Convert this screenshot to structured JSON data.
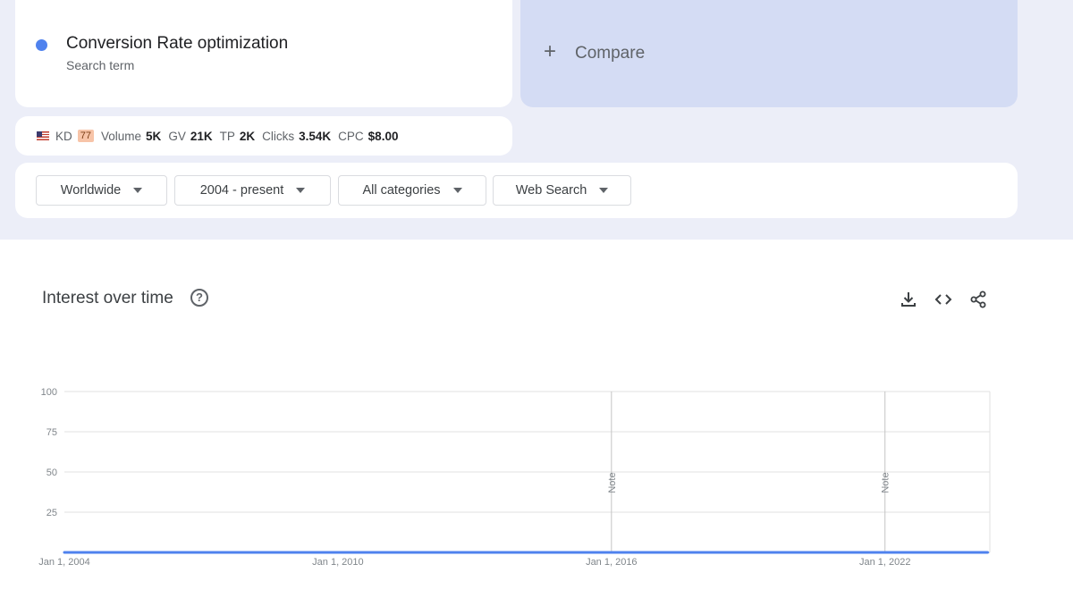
{
  "term": {
    "title": "Conversion Rate optimization",
    "subtitle": "Search term",
    "dot_color": "#4f82ee"
  },
  "compare": {
    "plus": "+",
    "label": "Compare"
  },
  "metrics": {
    "flag_icon": "us-flag-icon",
    "kd_label": "KD",
    "kd_value": "77",
    "volume_label": "Volume",
    "volume_value": "5K",
    "gv_label": "GV",
    "gv_value": "21K",
    "tp_label": "TP",
    "tp_value": "2K",
    "clicks_label": "Clicks",
    "clicks_value": "3.54K",
    "cpc_label": "CPC",
    "cpc_value": "$8.00"
  },
  "filters": {
    "region": "Worldwide",
    "time": "2004 - present",
    "category": "All categories",
    "search_type": "Web Search"
  },
  "chart_header": {
    "title": "Interest over time",
    "help": "?",
    "tools": [
      "download-icon",
      "embed-code-icon",
      "share-icon"
    ]
  },
  "chart_data": {
    "type": "line",
    "title": "",
    "line_color": "#4f82ee",
    "grid": true,
    "y_ticks": [
      25,
      50,
      75,
      100
    ],
    "ylim": [
      0,
      100
    ],
    "x_ticks": [
      "Jan 1, 2004",
      "Jan 1, 2010",
      "Jan 1, 2016",
      "Jan 1, 2022"
    ],
    "xlim": [
      2004.0,
      2024.3
    ],
    "notes": [
      {
        "x": 2016.0,
        "label": "Note"
      },
      {
        "x": 2022.0,
        "label": "Note"
      }
    ],
    "series": [
      {
        "name": "",
        "x": [
          2004.0,
          2005.0,
          2006.0,
          2007.0,
          2008.0,
          2009.0,
          2010.0,
          2010.5,
          2010.67,
          2010.75,
          2010.83,
          2010.92,
          2011.0,
          2011.08,
          2011.17,
          2011.25,
          2011.33,
          2011.42,
          2011.5,
          2011.58,
          2011.67,
          2011.75,
          2011.83,
          2011.92,
          2012.0,
          2012.08,
          2012.17,
          2012.25,
          2012.33,
          2012.42,
          2012.5,
          2012.58,
          2012.67,
          2012.75,
          2012.83,
          2012.92,
          2013.0,
          2013.08,
          2013.17,
          2013.25,
          2013.33,
          2013.42,
          2013.5,
          2013.58,
          2013.67,
          2013.75,
          2013.83,
          2013.92,
          2014.0,
          2014.08,
          2014.17,
          2014.25,
          2014.33,
          2014.42,
          2014.5,
          2014.58,
          2014.67,
          2014.75,
          2014.83,
          2014.92,
          2015.0,
          2015.08,
          2015.17,
          2015.25,
          2015.33,
          2015.42,
          2015.5,
          2015.58,
          2015.67,
          2015.75,
          2015.83,
          2015.92,
          2016.0,
          2016.08,
          2016.17,
          2016.25,
          2016.33,
          2016.42,
          2016.5,
          2016.58,
          2016.67,
          2016.75,
          2016.83,
          2016.92,
          2017.0,
          2017.08,
          2017.17,
          2017.25,
          2017.33,
          2017.42,
          2017.5,
          2017.58,
          2017.67,
          2017.75,
          2017.83,
          2017.92,
          2018.0,
          2018.08,
          2018.17,
          2018.25,
          2018.33,
          2018.42,
          2018.5,
          2018.58,
          2018.67,
          2018.75,
          2018.83,
          2018.92,
          2019.0,
          2019.08,
          2019.17,
          2019.25,
          2019.33,
          2019.42,
          2019.5,
          2019.58,
          2019.67,
          2019.75,
          2019.83,
          2019.92,
          2020.0,
          2020.08,
          2020.17,
          2020.25,
          2020.33,
          2020.42,
          2020.5,
          2020.58,
          2020.67,
          2020.75,
          2020.83,
          2020.92,
          2021.0,
          2021.08,
          2021.17,
          2021.25,
          2021.33,
          2021.42,
          2021.5,
          2021.58,
          2021.67,
          2021.75,
          2021.83,
          2021.92,
          2022.0,
          2022.08,
          2022.17,
          2022.25,
          2022.33,
          2022.42,
          2022.5,
          2022.58,
          2022.67,
          2022.75,
          2022.83,
          2022.92,
          2023.0,
          2023.08,
          2023.17,
          2023.25,
          2023.33,
          2023.42,
          2023.5,
          2023.58,
          2023.67,
          2023.75,
          2023.83,
          2023.92,
          2024.0,
          2024.08,
          2024.17,
          2024.25
        ],
        "values": [
          0,
          0,
          0,
          0,
          0,
          0,
          0,
          0,
          0,
          0,
          0,
          0,
          0,
          0,
          0,
          0,
          0,
          0,
          0,
          0,
          0,
          0,
          0,
          0,
          0,
          0,
          0,
          0,
          0,
          0,
          0,
          0,
          0,
          0,
          0,
          0,
          0,
          0,
          0,
          0,
          0,
          0,
          0,
          0,
          0,
          0,
          0,
          0,
          0,
          0,
          0,
          0,
          0,
          0,
          0,
          0,
          0,
          0,
          0,
          0,
          0,
          0,
          0,
          0,
          0,
          0,
          0,
          0,
          0,
          0,
          0,
          0,
          0,
          0,
          0,
          0,
          0,
          0,
          0,
          0,
          0,
          0,
          0,
          0,
          0,
          0,
          0,
          0,
          0,
          0,
          0,
          0,
          0,
          0,
          0,
          0,
          0,
          0,
          0,
          0,
          0,
          0,
          0,
          0,
          0,
          0,
          0,
          0,
          0,
          0,
          0,
          0,
          0,
          0,
          0,
          0,
          0,
          0,
          0,
          0,
          0,
          0,
          0,
          0,
          0,
          0,
          0,
          0,
          0,
          0,
          0,
          0,
          0,
          0,
          0,
          0,
          0,
          0,
          0,
          0,
          0,
          0,
          0,
          0,
          0,
          0,
          0,
          0,
          0,
          0,
          0,
          0,
          0,
          0,
          0,
          0,
          0,
          0,
          0,
          0,
          0,
          0,
          0,
          0,
          0,
          0,
          0,
          0,
          0,
          0,
          0,
          0
        ]
      }
    ]
  }
}
